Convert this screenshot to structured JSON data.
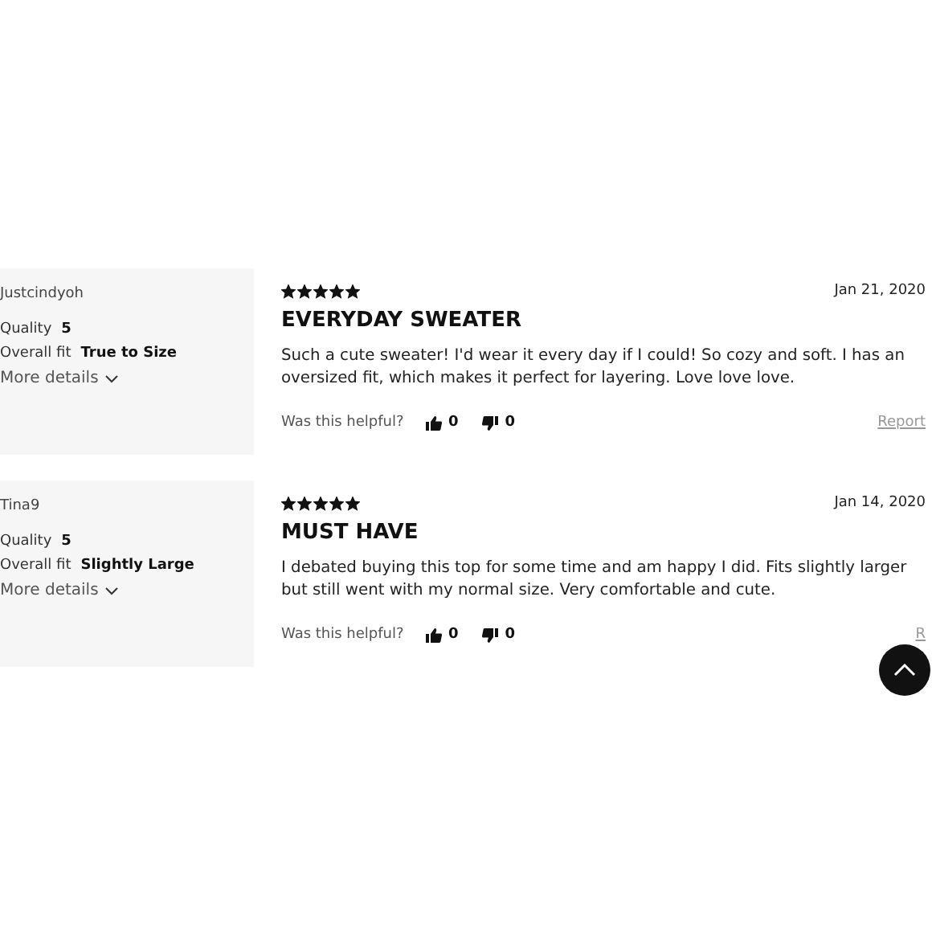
{
  "reviews": [
    {
      "author": "Justcindyoh",
      "quality_label": "Quality",
      "quality": "5",
      "fit_label": "Overall fit",
      "fit": "True to Size",
      "more": "More details",
      "stars": 5,
      "date": "Jan 21, 2020",
      "title": "EVERYDAY SWEATER",
      "body": "Such a cute sweater! I'd wear it every day if I could! So cozy and soft. I has an oversized fit, which makes it perfect for layering. Love love love.",
      "helpful": "Was this helpful?",
      "up": "0",
      "down": "0",
      "report": "Report"
    },
    {
      "author": "Tina9",
      "quality_label": "Quality",
      "quality": "5",
      "fit_label": "Overall fit",
      "fit": "Slightly Large",
      "more": "More details",
      "stars": 5,
      "date": "Jan 14, 2020",
      "title": "MUST HAVE",
      "body": "I debated buying this top for some time and am happy I did. Fits slightly larger but still went with my normal size. Very comfortable and cute.",
      "helpful": "Was this helpful?",
      "up": "0",
      "down": "0",
      "report": "R"
    }
  ]
}
